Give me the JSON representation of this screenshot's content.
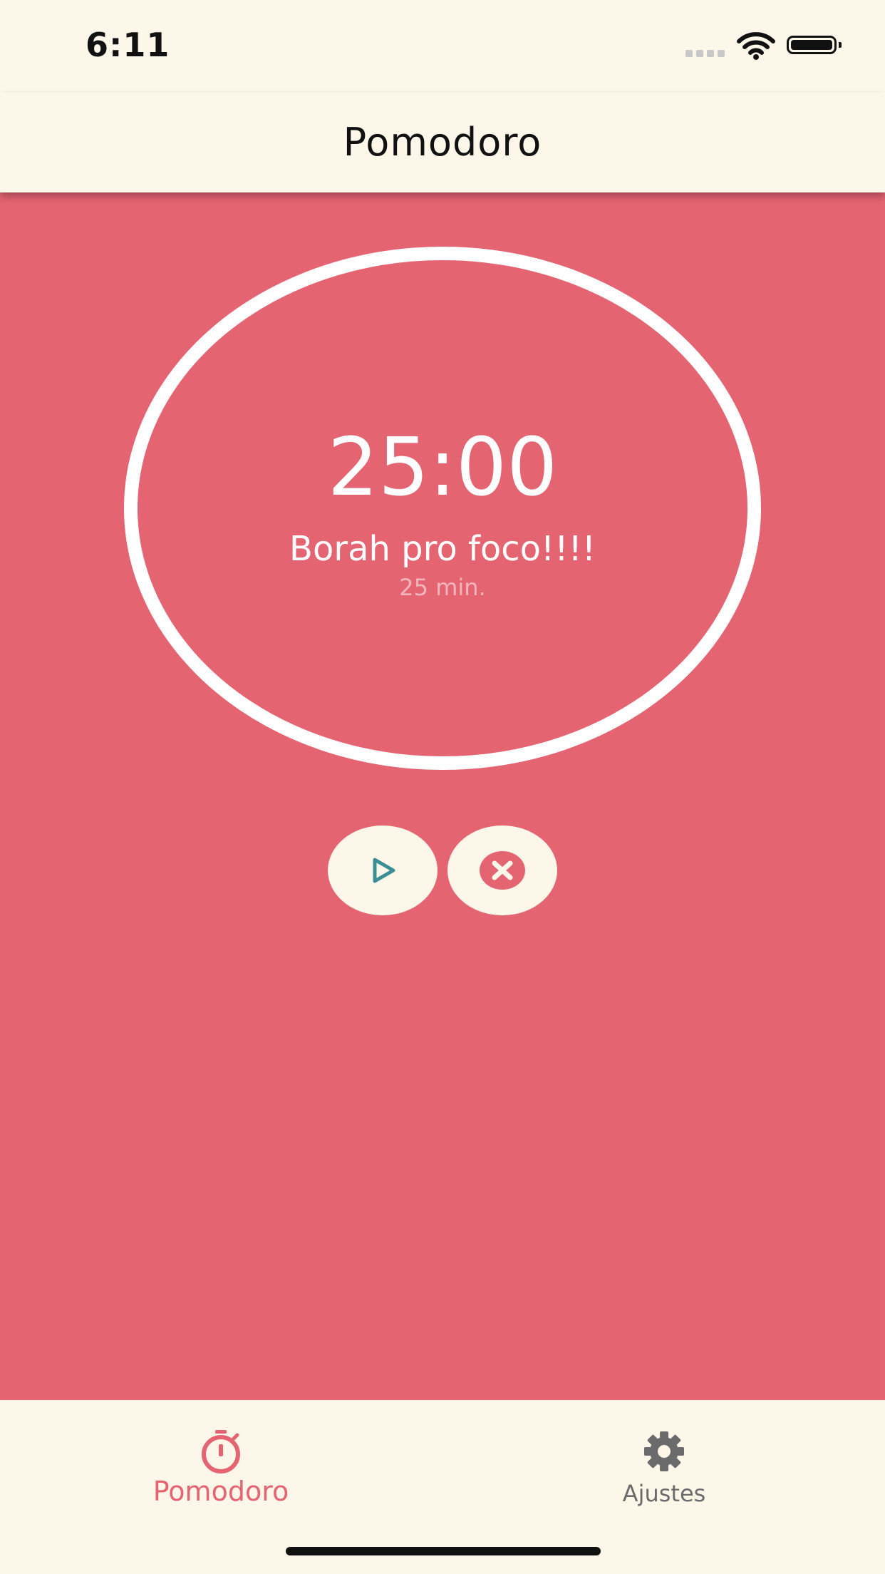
{
  "status_bar": {
    "time": "6:11",
    "signal_icon": "cellular-signal-icon",
    "wifi_icon": "wifi-icon",
    "battery_icon": "battery-icon"
  },
  "header": {
    "title": "Pomodoro"
  },
  "timer": {
    "remaining": "25:00",
    "phase_label": "Borah pro foco!!!!",
    "duration_label": "25 min."
  },
  "controls": {
    "play_icon": "play-icon",
    "cancel_icon": "cancel-circle-icon"
  },
  "bottom_nav": {
    "items": [
      {
        "label": "Pomodoro",
        "icon": "stopwatch-icon",
        "active": true
      },
      {
        "label": "Ajustes",
        "icon": "gear-icon",
        "active": false
      }
    ]
  },
  "colors": {
    "background_main": "#E46472",
    "surface": "#FDF7E9",
    "accent_play": "#3A8F96",
    "nav_active": "#E46472",
    "nav_inactive": "#6B6B6B"
  }
}
